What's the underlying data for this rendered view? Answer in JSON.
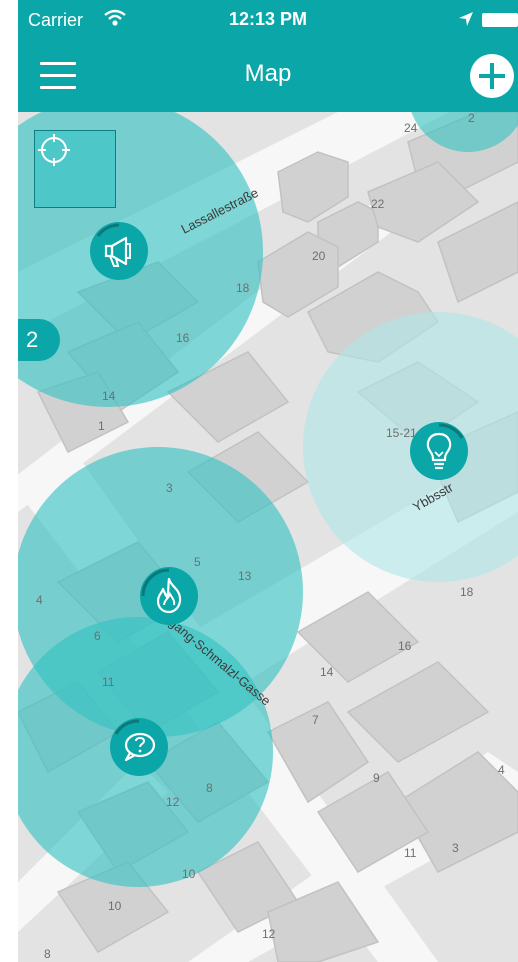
{
  "status_bar": {
    "carrier": "Carrier",
    "time": "12:13 PM"
  },
  "nav": {
    "title": "Map"
  },
  "map": {
    "street_names": [
      "Lassallestraße",
      "Ybbsstr",
      "gang-Schmalzl-Gasse"
    ],
    "house_numbers": [
      "24",
      "2",
      "22",
      "20",
      "18",
      "16",
      "14",
      "1",
      "15-21",
      "3",
      "5",
      "13",
      "4",
      "6",
      "11",
      "18",
      "16",
      "14",
      "7",
      "9",
      "4",
      "12",
      "8",
      "11",
      "3",
      "10",
      "10",
      "12",
      "8"
    ],
    "cluster_count": "2"
  },
  "colors": {
    "accent": "#0aa6a8",
    "area": "#33c1c1"
  },
  "markers": [
    {
      "icon": "megaphone-icon"
    },
    {
      "icon": "lightbulb-icon"
    },
    {
      "icon": "flame-icon"
    },
    {
      "icon": "question-bubble-icon"
    }
  ]
}
